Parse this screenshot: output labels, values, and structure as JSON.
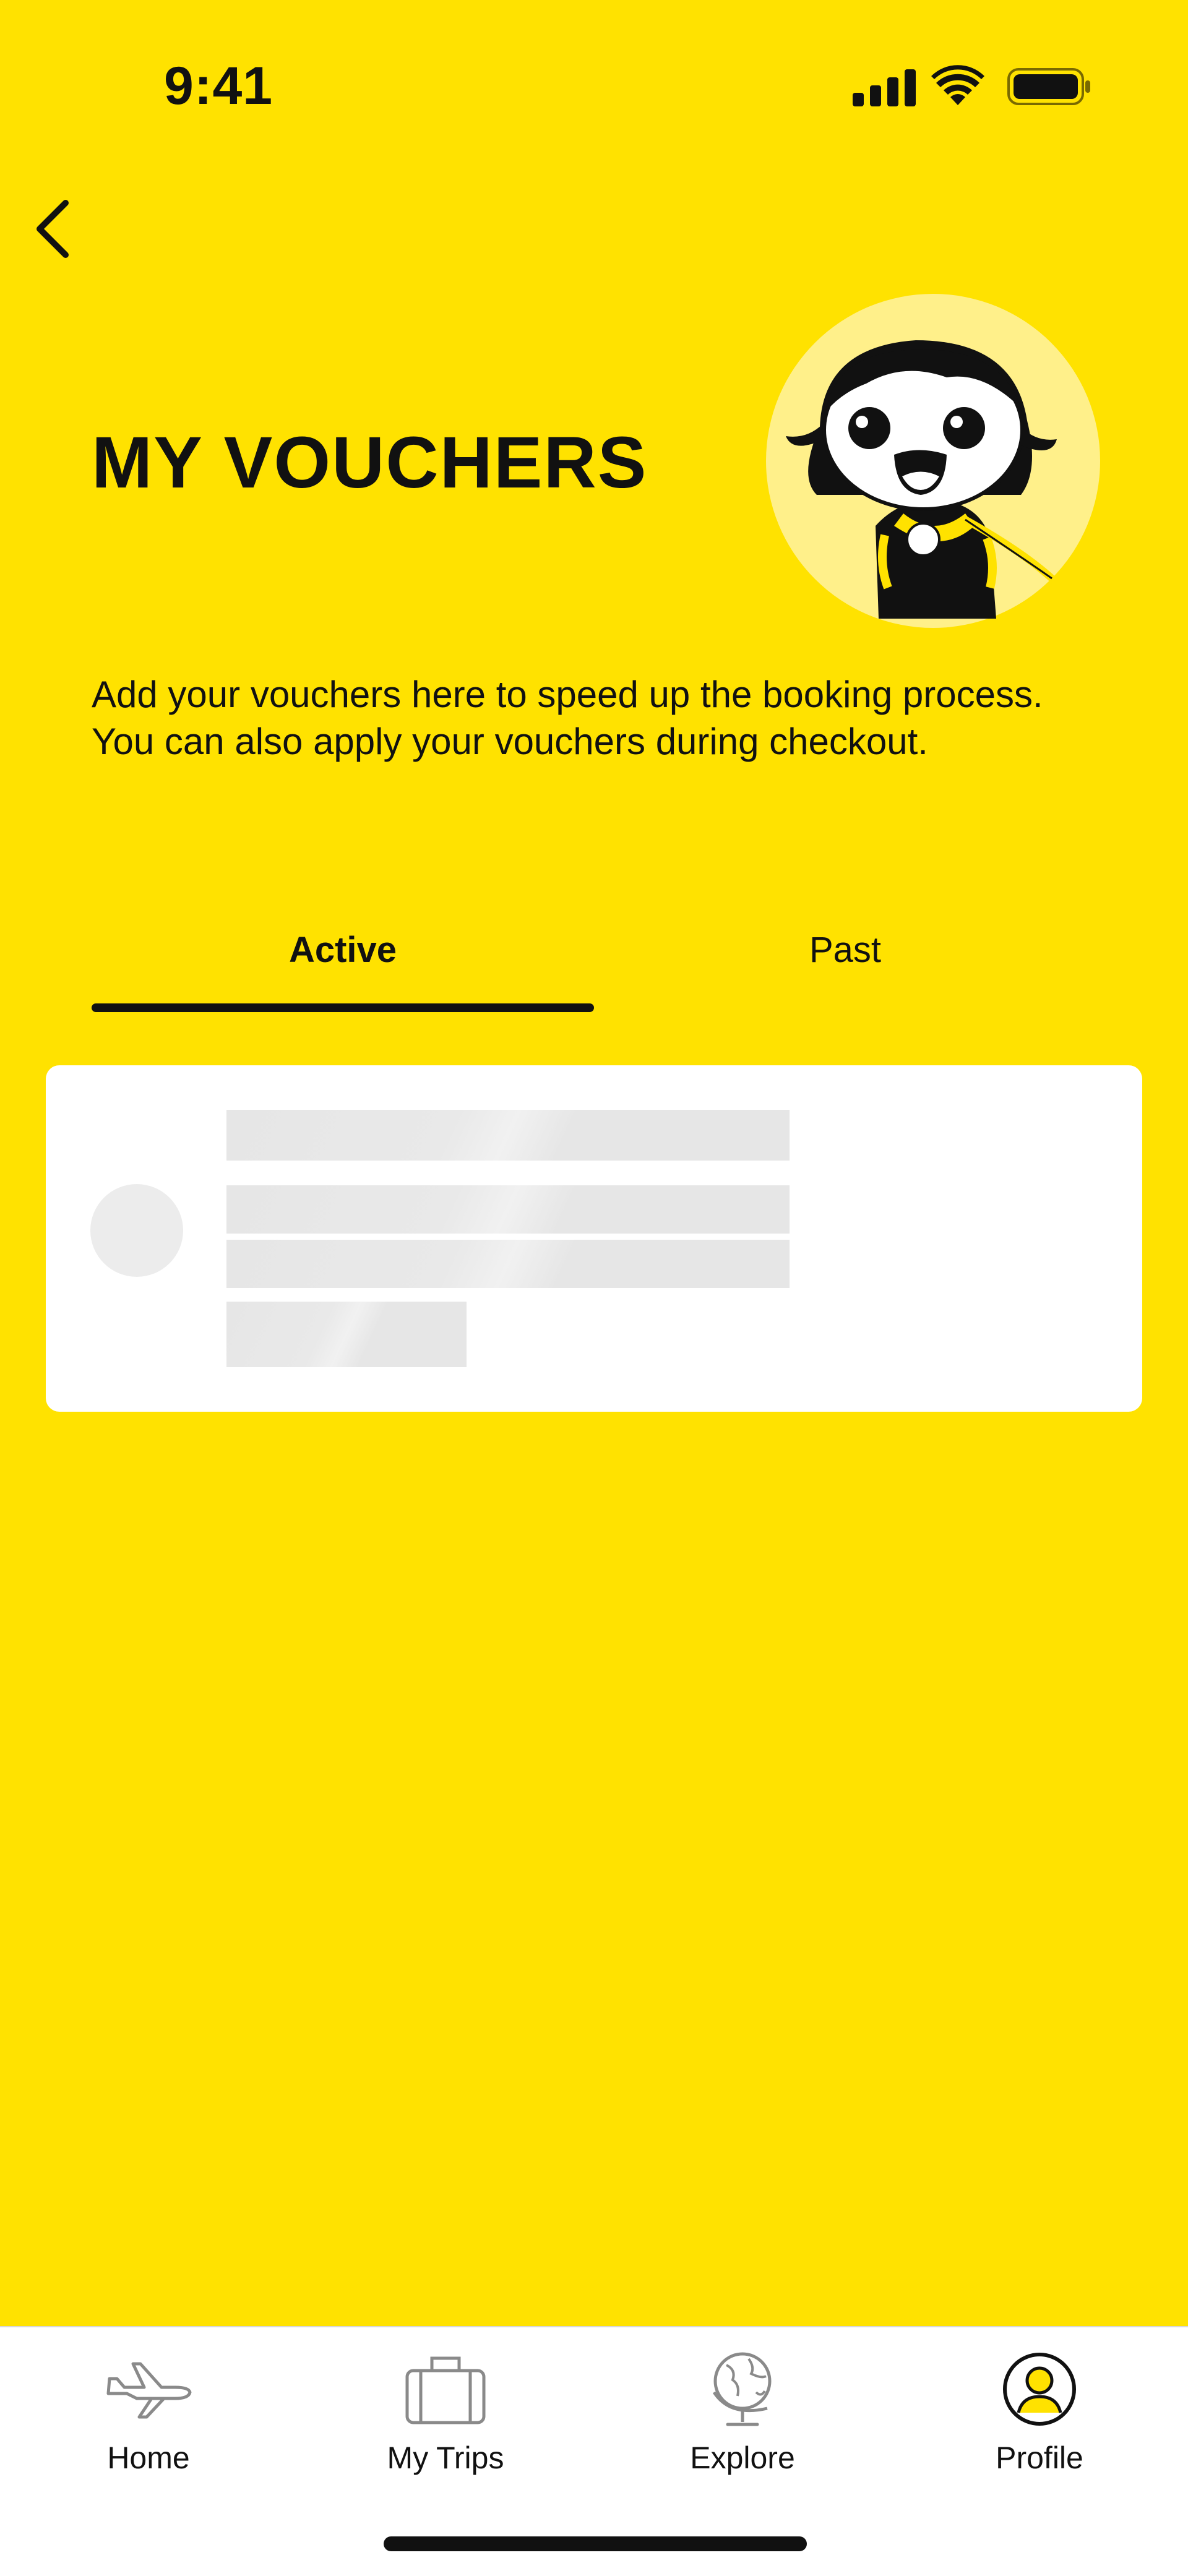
{
  "status_bar": {
    "time": "9:41",
    "icons": [
      "signal-icon",
      "wifi-icon",
      "battery-icon"
    ]
  },
  "header": {
    "back_icon": "chevron-left-icon",
    "title": "MY VOUCHERS",
    "mascot": "mascot-illustration",
    "description": "Add your vouchers here to speed up the booking process. You can also apply your vouchers during checkout."
  },
  "tabs": [
    {
      "label": "Active",
      "selected": true
    },
    {
      "label": "Past",
      "selected": false
    }
  ],
  "voucher_list": {
    "state": "loading-skeleton"
  },
  "bottom_nav": {
    "items": [
      {
        "label": "Home",
        "icon": "airplane-icon",
        "selected": false
      },
      {
        "label": "My Trips",
        "icon": "suitcase-icon",
        "selected": false
      },
      {
        "label": "Explore",
        "icon": "globe-icon",
        "selected": false
      },
      {
        "label": "Profile",
        "icon": "profile-icon",
        "selected": true
      }
    ]
  },
  "colors": {
    "background": "#FFE200",
    "text": "#111111",
    "card": "#FFFFFF",
    "skeleton": "#E6E6E6"
  }
}
